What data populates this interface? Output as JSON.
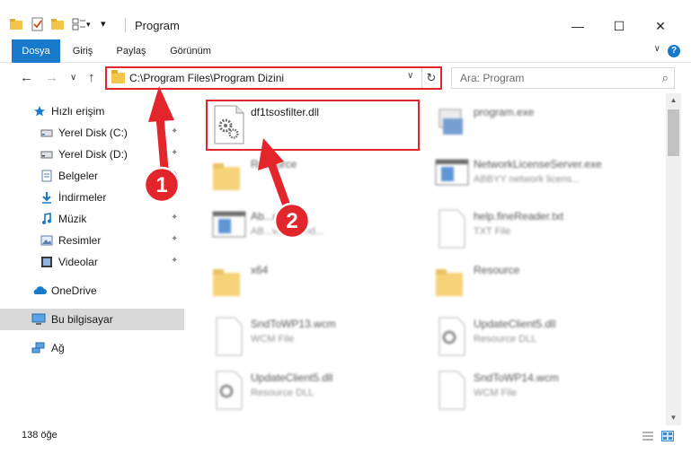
{
  "window": {
    "title": "Program",
    "minimize_glyph": "—",
    "maximize_glyph": "☐",
    "close_glyph": "✕"
  },
  "ribbon": {
    "tabs": [
      "Dosya",
      "Giriş",
      "Paylaş",
      "Görünüm"
    ],
    "help_glyph": "?",
    "expand_glyph": "∨"
  },
  "nav": {
    "back_glyph": "←",
    "forward_glyph": "→",
    "recent_glyph": "∨",
    "up_glyph": "↑",
    "address": "C:\\Program Files\\Program Dizini",
    "address_dropdown_glyph": "∨",
    "refresh_glyph": "↻",
    "search_placeholder": "Ara: Program",
    "search_glyph": "⌕"
  },
  "sidebar": {
    "items": [
      {
        "label": "Hızlı erişim",
        "icon": "star-icon",
        "pinned": false
      },
      {
        "label": "Yerel Disk (C:)",
        "icon": "drive-icon",
        "pinned": true
      },
      {
        "label": "Yerel Disk (D:)",
        "icon": "drive-icon",
        "pinned": true
      },
      {
        "label": "Belgeler",
        "icon": "documents-icon",
        "pinned": true
      },
      {
        "label": "İndirmeler",
        "icon": "download-icon",
        "pinned": true
      },
      {
        "label": "Müzik",
        "icon": "music-icon",
        "pinned": true
      },
      {
        "label": "Resimler",
        "icon": "pictures-icon",
        "pinned": true
      },
      {
        "label": "Videolar",
        "icon": "video-icon",
        "pinned": true
      },
      {
        "label": "OneDrive",
        "icon": "cloud-icon",
        "pinned": false
      },
      {
        "label": "Bu bilgisayar",
        "icon": "computer-icon",
        "pinned": false,
        "selected": true
      },
      {
        "label": "Ağ",
        "icon": "network-icon",
        "pinned": false
      }
    ],
    "pin_glyph": "📌"
  },
  "files": [
    {
      "name": "df1tsosfilter.dll",
      "type": "",
      "icon": "dll-gear-icon",
      "highlighted": true
    },
    {
      "name": "program.exe",
      "type": "",
      "icon": "exe-icon"
    },
    {
      "name": "Resource",
      "type": "",
      "icon": "folder-icon"
    },
    {
      "name": "NetworkLicenseServer.exe",
      "type": "ABBYY network licens...",
      "icon": "exe-window-icon"
    },
    {
      "name": "Ab...exe",
      "type": "AB...vant hand...",
      "icon": "exe-window-icon"
    },
    {
      "name": "help.fineReader.txt",
      "type": "TXT File",
      "icon": "txt-icon"
    },
    {
      "name": "x64",
      "type": "",
      "icon": "folder-icon"
    },
    {
      "name": "Resource",
      "type": "",
      "icon": "folder-icon"
    },
    {
      "name": "SndToWP13.wcm",
      "type": "WCM File",
      "icon": "blank-file-icon"
    },
    {
      "name": "UpdateClient5.dll",
      "type": "Resource DLL",
      "icon": "dll-gear-icon"
    },
    {
      "name": "UpdateClient5.dll",
      "type": "Resource DLL",
      "icon": "dll-gear-icon"
    },
    {
      "name": "SndToWP14.wcm",
      "type": "WCM File",
      "icon": "blank-file-icon"
    }
  ],
  "status": {
    "count": "138 öğe"
  },
  "annotations": {
    "badge1": "1",
    "badge2": "2"
  },
  "colors": {
    "accent": "#1979ca",
    "annotation_red": "#e2262b",
    "folder": "#f3c54c",
    "selected_bg": "#d9d9d9"
  }
}
